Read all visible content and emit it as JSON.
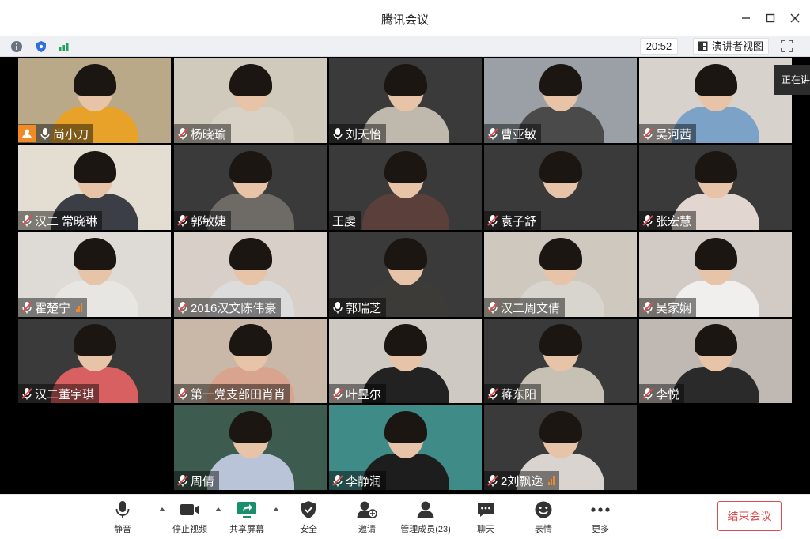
{
  "window": {
    "title": "腾讯会议"
  },
  "infobar": {
    "time": "20:52",
    "speaker_view_label": "演讲者视图"
  },
  "sharing_tab": {
    "label": "正在讲"
  },
  "participants": [
    {
      "name": "尚小刀",
      "host": true,
      "muted": false,
      "signal": false,
      "tone": "#b9a989",
      "shirt": "#e8a22a"
    },
    {
      "name": "杨晓瑜",
      "host": false,
      "muted": true,
      "signal": false,
      "tone": "#cfcabb",
      "shirt": "#d8d2c6"
    },
    {
      "name": "刘天怡",
      "host": false,
      "muted": false,
      "signal": false,
      "tone": "#3a3a3a",
      "shirt": "#bfb8ac"
    },
    {
      "name": "曹亚敏",
      "host": false,
      "muted": true,
      "signal": false,
      "tone": "#9aa0a6",
      "shirt": "#4a4a4a"
    },
    {
      "name": "吴河茜",
      "host": false,
      "muted": true,
      "signal": false,
      "tone": "#d7d2cc",
      "shirt": "#7da2c7"
    },
    {
      "name": "汉二  常晓琳",
      "host": false,
      "muted": true,
      "signal": false,
      "tone": "#e3ddd2",
      "shirt": "#3b3e45"
    },
    {
      "name": "郭敏婕",
      "host": false,
      "muted": true,
      "signal": false,
      "tone": "#3a3a3a",
      "shirt": "#6e6a66"
    },
    {
      "name": "王虔",
      "host": false,
      "muted": false,
      "signal": false,
      "tone": "#3a3a3a",
      "shirt": "#5a3f3b"
    },
    {
      "name": "袁子舒",
      "host": false,
      "muted": true,
      "signal": false,
      "tone": "#3a3a3a",
      "shirt": "#3a3a3a"
    },
    {
      "name": "张宏慧",
      "host": false,
      "muted": true,
      "signal": false,
      "tone": "#3a3a3a",
      "shirt": "#e2d6d0"
    },
    {
      "name": "霍楚宁",
      "host": false,
      "muted": true,
      "signal": true,
      "tone": "#dedbd6",
      "shirt": "#e8e6e2"
    },
    {
      "name": "2016汉文陈伟豪",
      "host": false,
      "muted": true,
      "signal": false,
      "tone": "#d8cfc8",
      "shirt": "#dcdcdc"
    },
    {
      "name": "郭瑞芝",
      "host": false,
      "muted": false,
      "signal": false,
      "tone": "#3a3a3a",
      "shirt": "#3d3b38"
    },
    {
      "name": "汉二周文倩",
      "host": false,
      "muted": true,
      "signal": false,
      "tone": "#cfc8be",
      "shirt": "#d8d4ce"
    },
    {
      "name": "吴家娴",
      "host": false,
      "muted": true,
      "signal": false,
      "tone": "#d2cac4",
      "shirt": "#f0efee"
    },
    {
      "name": "汉二董宇琪",
      "host": false,
      "muted": true,
      "signal": false,
      "tone": "#3a3a3a",
      "shirt": "#d86060"
    },
    {
      "name": "第一党支部田肖肖",
      "host": false,
      "muted": true,
      "signal": false,
      "tone": "#c9b8a8",
      "shirt": "#d9a48e"
    },
    {
      "name": "叶昱尔",
      "host": false,
      "muted": true,
      "signal": false,
      "tone": "#cfc9c4",
      "shirt": "#222222"
    },
    {
      "name": "蒋东阳",
      "host": false,
      "muted": true,
      "signal": false,
      "tone": "#3a3a3a",
      "shirt": "#c7c0b5"
    },
    {
      "name": "李悦",
      "host": false,
      "muted": true,
      "signal": false,
      "tone": "#bfb8b3",
      "shirt": "#2a2a2a"
    },
    {
      "name": "周倩",
      "host": false,
      "muted": true,
      "signal": false,
      "tone": "#3d5b4e",
      "shirt": "#b9c4d9"
    },
    {
      "name": "李静润",
      "host": false,
      "muted": true,
      "signal": false,
      "tone": "#3f8b87",
      "shirt": "#1d1d1d"
    },
    {
      "name": "2刘飘逸",
      "host": false,
      "muted": true,
      "signal": true,
      "tone": "#3a3a3a",
      "shirt": "#d9d4cf"
    }
  ],
  "toolbar": {
    "mute": "静音",
    "stop_video": "停止视频",
    "share_screen": "共享屏幕",
    "security": "安全",
    "invite": "邀请",
    "manage_members": "管理成员(23)",
    "chat": "聊天",
    "reactions": "表情",
    "more": "更多",
    "end_meeting": "结束会议"
  },
  "colors": {
    "accent": "#f08a24",
    "end_red": "#e24b4b",
    "stage_bg": "#000000",
    "share_green": "#1a8f6e"
  }
}
